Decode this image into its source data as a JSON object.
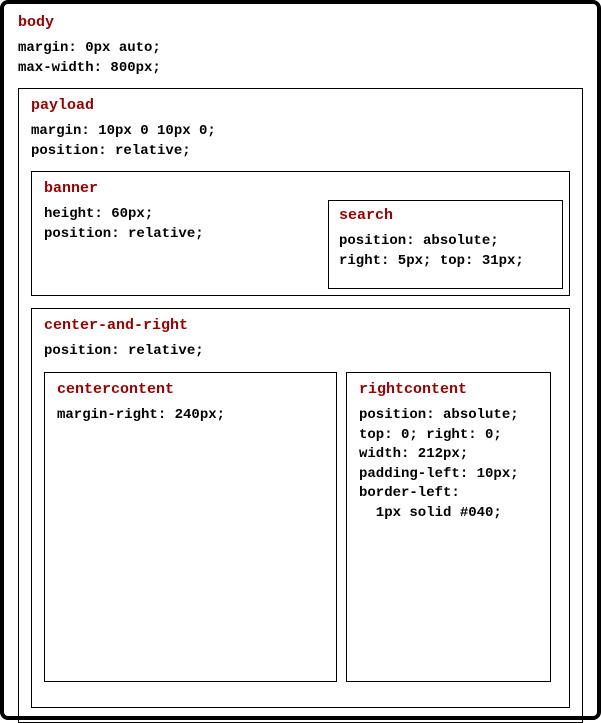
{
  "body": {
    "title": "body",
    "props": "margin: 0px auto;\nmax-width: 800px;"
  },
  "payload": {
    "title": "payload",
    "props": "margin: 10px 0 10px 0;\nposition: relative;"
  },
  "banner": {
    "title": "banner",
    "props": "height: 60px;\nposition: relative;"
  },
  "search": {
    "title": "search",
    "props": "position: absolute;\nright: 5px; top: 31px;"
  },
  "centerAndRight": {
    "title": "center-and-right",
    "props": "position: relative;"
  },
  "centerContent": {
    "title": "centercontent",
    "props": "margin-right: 240px;"
  },
  "rightContent": {
    "title": "rightcontent",
    "props": "position: absolute;\ntop: 0; right: 0;\nwidth: 212px;\npadding-left: 10px;\nborder-left:\n  1px solid #040;"
  }
}
